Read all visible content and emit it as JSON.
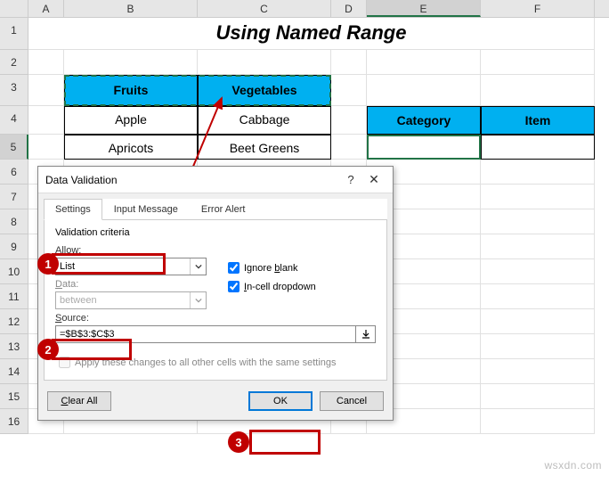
{
  "columns": [
    "A",
    "B",
    "C",
    "D",
    "E",
    "F"
  ],
  "rowCount": 16,
  "title": "Using Named Range",
  "table1": {
    "headers": [
      "Fruits",
      "Vegetables"
    ],
    "rows": [
      [
        "Apple",
        "Cabbage"
      ],
      [
        "Apricots",
        "Beet Greens"
      ]
    ]
  },
  "table2": {
    "headers": [
      "Category",
      "Item"
    ]
  },
  "activeCell": "E5",
  "marqueeRange": "B3:C3",
  "dialog": {
    "title": "Data Validation",
    "help": "?",
    "close": "✕",
    "tabs": [
      "Settings",
      "Input Message",
      "Error Alert"
    ],
    "activeTab": 0,
    "criteria_label": "Validation criteria",
    "allow": {
      "label": "Allow:",
      "value": "List"
    },
    "data": {
      "label": "Data:",
      "value": "between"
    },
    "ignore_blank": {
      "label": "Ignore blank",
      "checked": true
    },
    "incell_dropdown": {
      "label": "In-cell dropdown",
      "checked": true
    },
    "source": {
      "label": "Source:",
      "value": "=$B$3:$C$3"
    },
    "apply_same": "Apply these changes to all other cells with the same settings",
    "clear_all": "Clear All",
    "ok": "OK",
    "cancel": "Cancel"
  },
  "badges": [
    "1",
    "2",
    "3"
  ],
  "watermark": "wsxdn.com"
}
